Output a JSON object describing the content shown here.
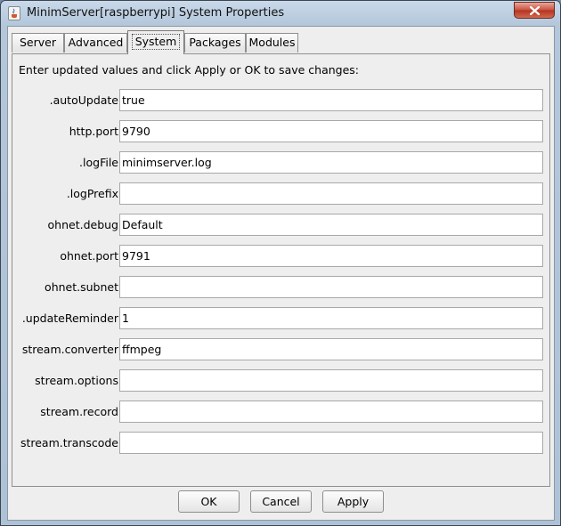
{
  "window": {
    "title": "MinimServer[raspberrypi] System Properties",
    "app_icon": "java-cup-icon",
    "close_icon": "close-icon"
  },
  "tabs": [
    {
      "label": "Server",
      "active": false
    },
    {
      "label": "Advanced",
      "active": false
    },
    {
      "label": "System",
      "active": true
    },
    {
      "label": "Packages",
      "active": false
    },
    {
      "label": "Modules",
      "active": false
    }
  ],
  "panel": {
    "instructions": "Enter updated values and click Apply or OK to save changes:"
  },
  "fields": [
    {
      "label": ".autoUpdate",
      "value": "true"
    },
    {
      "label": "http.port",
      "value": "9790"
    },
    {
      "label": ".logFile",
      "value": "minimserver.log"
    },
    {
      "label": ".logPrefix",
      "value": ""
    },
    {
      "label": "ohnet.debug",
      "value": "Default"
    },
    {
      "label": "ohnet.port",
      "value": "9791"
    },
    {
      "label": "ohnet.subnet",
      "value": ""
    },
    {
      "label": ".updateReminder",
      "value": "1"
    },
    {
      "label": "stream.converter",
      "value": "ffmpeg"
    },
    {
      "label": "stream.options",
      "value": ""
    },
    {
      "label": "stream.record",
      "value": ""
    },
    {
      "label": "stream.transcode",
      "value": ""
    }
  ],
  "buttons": {
    "ok": "OK",
    "cancel": "Cancel",
    "apply": "Apply"
  }
}
